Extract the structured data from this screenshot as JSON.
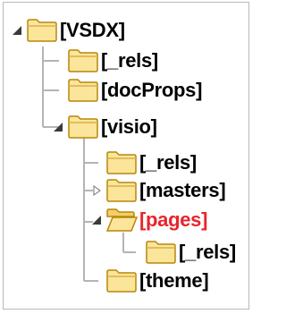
{
  "tree": {
    "nodes": [
      {
        "id": "vsdx",
        "label": "[VSDX]",
        "state": "expanded",
        "selected": false
      },
      {
        "id": "rels-root",
        "label": "[_rels]",
        "state": "leaf",
        "selected": false
      },
      {
        "id": "docprops",
        "label": "[docProps]",
        "state": "leaf",
        "selected": false
      },
      {
        "id": "visio",
        "label": "[visio]",
        "state": "expanded",
        "selected": false
      },
      {
        "id": "rels-visio",
        "label": "[_rels]",
        "state": "leaf",
        "selected": false
      },
      {
        "id": "masters",
        "label": "[masters]",
        "state": "collapsed",
        "selected": false
      },
      {
        "id": "pages",
        "label": "[pages]",
        "state": "expanded",
        "selected": true
      },
      {
        "id": "rels-pages",
        "label": "[_rels]",
        "state": "leaf",
        "selected": false
      },
      {
        "id": "theme",
        "label": "[theme]",
        "state": "leaf",
        "selected": false
      }
    ]
  },
  "colors": {
    "selected_label": "#e8242b",
    "folder_fill": "#fbe59a",
    "folder_stroke": "#b8860b",
    "guide": "#b4b4b4"
  },
  "icons": {
    "folder": "folder-closed-icon",
    "folder_open": "folder-open-icon",
    "expanded": "expanded-triangle-icon",
    "collapsed": "collapsed-triangle-icon"
  }
}
